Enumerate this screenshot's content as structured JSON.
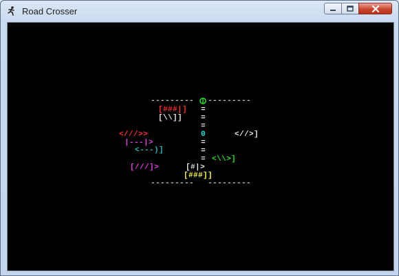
{
  "window": {
    "title": "Road Crosser",
    "controls": {
      "minimize": "minimize",
      "maximize": "maximize",
      "close": "close"
    }
  },
  "game": {
    "road_top_left": "---------",
    "road_top_right": "---------",
    "road_bottom_left": "---------",
    "road_bottom_right": "---------",
    "goal": "0",
    "player": "0",
    "median_marks": [
      "=",
      "=",
      "=",
      "=",
      "=",
      "=",
      "="
    ],
    "vehicles": [
      {
        "id": "red-truck",
        "text": "[###|]",
        "color": "#ff3030"
      },
      {
        "id": "white-car-1",
        "text": "[\\\\]]",
        "color": "#e6e6e6"
      },
      {
        "id": "red-car",
        "text": "<///>>",
        "color": "#ff3030"
      },
      {
        "id": "white-car-2",
        "text": "<//>]",
        "color": "#e6e6e6"
      },
      {
        "id": "magenta-car-1",
        "text": "|---|>",
        "color": "#e040e0"
      },
      {
        "id": "cyan-car",
        "text": "<---)]",
        "color": "#1fb8b8"
      },
      {
        "id": "green-car",
        "text": "<\\\\>]",
        "color": "#20e020"
      },
      {
        "id": "magenta-car-2",
        "text": "[///]>",
        "color": "#e040e0"
      },
      {
        "id": "white-car-3",
        "text": "[#|>",
        "color": "#e6e6e6"
      },
      {
        "id": "yellow-truck",
        "text": "[###]]",
        "color": "#ffff30"
      }
    ],
    "colors": {
      "goal": "#20e020",
      "player": "#20e0e0",
      "road": "#c0c0c0"
    }
  }
}
